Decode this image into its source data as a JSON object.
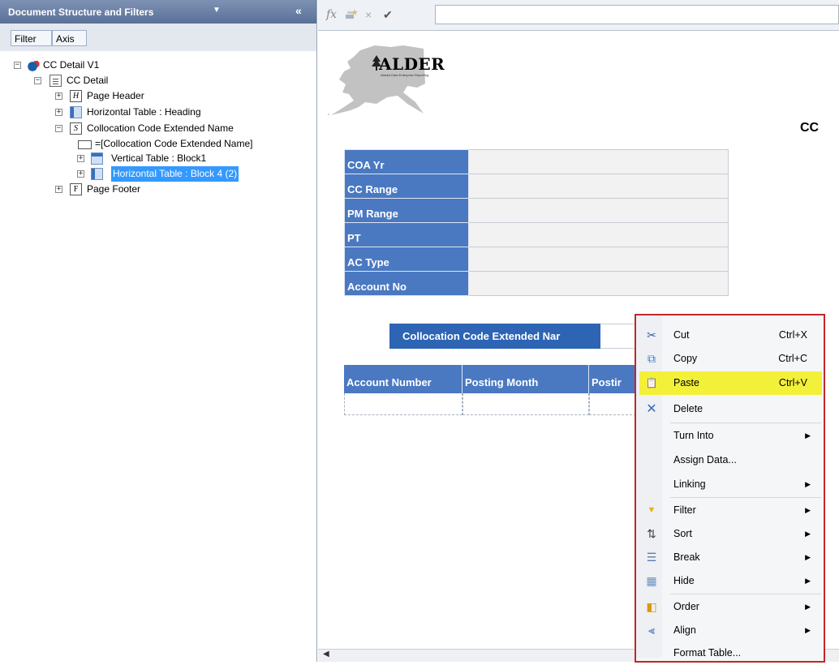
{
  "left_panel": {
    "title": "Document Structure and Filters",
    "title_arrow": "▼",
    "collapse": "«",
    "tabs": [
      "Filter",
      "Axis"
    ],
    "tree": [
      {
        "label": "CC Detail V1",
        "expander": "−",
        "icon": "report-icon"
      },
      {
        "label": "CC Detail",
        "expander": "−",
        "icon": "document-icon"
      },
      {
        "label": "Page Header",
        "expander": "+",
        "icon": "H",
        "icon_name": "page-header-icon"
      },
      {
        "label": "Horizontal Table : Heading",
        "expander": "+",
        "icon": "table-icon"
      },
      {
        "label": "Collocation Code Extended Name",
        "expander": "−",
        "icon": "S",
        "icon_name": "section-icon"
      },
      {
        "label": "=[Collocation Code Extended Name]",
        "expander": "",
        "icon": "cell-icon"
      },
      {
        "label": "Vertical Table : Block1",
        "expander": "+",
        "icon": "vertical-table-icon"
      },
      {
        "label": "Horizontal Table : Block 4 (2)",
        "expander": "+",
        "icon": "table-icon",
        "selected": true
      },
      {
        "label": "Page Footer",
        "expander": "+",
        "icon": "F",
        "icon_name": "page-footer-icon"
      }
    ]
  },
  "formula_bar": {
    "fx": "fx",
    "cancel": "×",
    "validate": "✔",
    "value": ""
  },
  "report": {
    "logo_text": "ALDER",
    "logo_tagline": "Alaska Data Enterprise Reporting",
    "title": "CC",
    "prompts": [
      "COA Yr",
      "CC Range",
      "PM Range",
      "PT",
      "AC Type",
      "Account No"
    ],
    "section_header": "Collocation Code Extended Nar",
    "block_headers": [
      "Account Number",
      "Posting Month",
      "Postir"
    ]
  },
  "context_menu": {
    "items": [
      {
        "label": "Cut",
        "shortcut": "Ctrl+X",
        "icon": "✂",
        "icon_name": "scissors-icon"
      },
      {
        "label": "Copy",
        "shortcut": "Ctrl+C",
        "icon": "⧉",
        "icon_name": "copy-icon"
      },
      {
        "label": "Paste",
        "shortcut": "Ctrl+V",
        "icon": "📋",
        "icon_name": "clipboard-icon",
        "highlighted": true
      },
      {
        "label": "Delete",
        "shortcut": "",
        "icon": "✕",
        "icon_name": "delete-icon"
      },
      {
        "label": "Turn Into",
        "submenu": true
      },
      {
        "label": "Assign Data...",
        "submenu": false
      },
      {
        "label": "Linking",
        "submenu": true
      },
      {
        "label": "Filter",
        "submenu": true,
        "icon": "▼",
        "icon_name": "funnel-icon"
      },
      {
        "label": "Sort",
        "submenu": true,
        "icon": "⇅",
        "icon_name": "sort-icon"
      },
      {
        "label": "Break",
        "submenu": true,
        "icon": "☰",
        "icon_name": "break-icon"
      },
      {
        "label": "Hide",
        "submenu": true,
        "icon": "▦",
        "icon_name": "hide-icon"
      },
      {
        "label": "Order",
        "submenu": true,
        "icon": "◧",
        "icon_name": "order-icon"
      },
      {
        "label": "Align",
        "submenu": true,
        "icon": "⫷",
        "icon_name": "align-icon"
      },
      {
        "label": "Format Table...",
        "submenu": false
      }
    ],
    "submenu_arrow": "▶"
  },
  "scroll": {
    "left_arrow": "◀"
  }
}
